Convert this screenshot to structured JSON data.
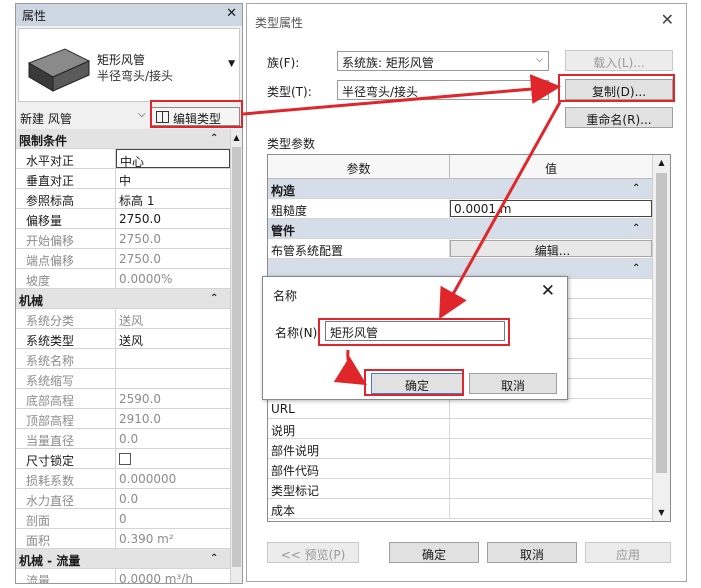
{
  "properties": {
    "title": "属性",
    "type_name": "矩形风管",
    "type_sub": "半径弯头/接头",
    "new_label": "新建 风管",
    "edit_type": "编辑类型",
    "rows": [
      {
        "kind": "sec",
        "k": "限制条件"
      },
      {
        "k": "水平对正",
        "v": "中心",
        "active": true
      },
      {
        "k": "垂直对正",
        "v": "中"
      },
      {
        "k": "参照标高",
        "v": "标高 1"
      },
      {
        "k": "偏移量",
        "v": "2750.0"
      },
      {
        "k": "开始偏移",
        "v": "2750.0",
        "dis": true
      },
      {
        "k": "端点偏移",
        "v": "2750.0",
        "dis": true
      },
      {
        "k": "坡度",
        "v": "0.0000%",
        "dis": true
      },
      {
        "kind": "sec",
        "k": "机械"
      },
      {
        "k": "系统分类",
        "v": "送风",
        "dis": true
      },
      {
        "k": "系统类型",
        "v": "送风"
      },
      {
        "k": "系统名称",
        "v": "",
        "dis": true
      },
      {
        "k": "系统缩写",
        "v": "",
        "dis": true
      },
      {
        "k": "底部高程",
        "v": "2590.0",
        "dis": true
      },
      {
        "k": "顶部高程",
        "v": "2910.0",
        "dis": true
      },
      {
        "k": "当量直径",
        "v": "0.0",
        "dis": true
      },
      {
        "k": "尺寸锁定",
        "v": "",
        "check": true
      },
      {
        "k": "损耗系数",
        "v": "0.000000",
        "dis": true
      },
      {
        "k": "水力直径",
        "v": "0.0",
        "dis": true
      },
      {
        "k": "剖面",
        "v": "0",
        "dis": true
      },
      {
        "k": "面积",
        "v": "0.390 m²",
        "dis": true
      },
      {
        "kind": "sec",
        "k": "机械 - 流量"
      },
      {
        "k": "流量",
        "v": "0.0000 m³/h",
        "dis": true
      }
    ]
  },
  "type_dialog": {
    "title": "类型属性",
    "family_label": "族(F):",
    "family_value": "系统族: 矩形风管",
    "type_label": "类型(T):",
    "type_value": "半径弯头/接头",
    "load_btn": "载入(L)...",
    "dup_btn": "复制(D)...",
    "rename_btn": "重命名(R)...",
    "params_label": "类型参数",
    "col_param": "参数",
    "col_value": "值",
    "rows": [
      {
        "kind": "sec",
        "k": "构造"
      },
      {
        "k": "粗糙度",
        "v": "0.0001 m",
        "ed": true
      },
      {
        "kind": "sec",
        "k": "管件"
      },
      {
        "k": "布管系统配置",
        "v": "编辑...",
        "btn": true
      },
      {
        "kind": "sec",
        "k": ""
      },
      {
        "k": "",
        "v": ""
      },
      {
        "k": "",
        "v": ""
      },
      {
        "k": "",
        "v": ""
      },
      {
        "k": "",
        "v": ""
      },
      {
        "k": "",
        "v": ""
      },
      {
        "k": "",
        "v": ""
      },
      {
        "k": "URL",
        "v": ""
      },
      {
        "k": "说明",
        "v": ""
      },
      {
        "k": "部件说明",
        "v": ""
      },
      {
        "k": "部件代码",
        "v": ""
      },
      {
        "k": "类型标记",
        "v": ""
      },
      {
        "k": "成本",
        "v": ""
      }
    ],
    "preview_btn": "<< 预览(P)",
    "ok_btn": "确定",
    "cancel_btn": "取消",
    "apply_btn": "应用"
  },
  "name_dialog": {
    "title": "名称",
    "label": "名称(N)",
    "value": "矩形风管",
    "ok": "确定",
    "cancel": "取消"
  },
  "colors": {
    "highlight": "#e0262a",
    "section": "#d4dde8"
  }
}
